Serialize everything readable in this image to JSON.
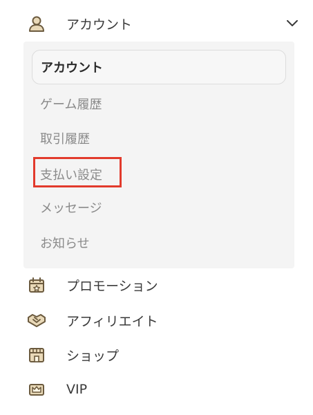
{
  "account": {
    "label": "アカウント",
    "icon": "user-icon",
    "expanded": true
  },
  "submenu": {
    "items": [
      {
        "label": "アカウント",
        "active": true
      },
      {
        "label": "ゲーム履歴"
      },
      {
        "label": "取引履歴"
      },
      {
        "label": "支払い設定",
        "highlighted": true
      },
      {
        "label": "メッセージ"
      },
      {
        "label": "お知らせ"
      }
    ]
  },
  "nav": {
    "items": [
      {
        "label": "プロモーション",
        "icon": "promotion-gift-icon"
      },
      {
        "label": "アフィリエイト",
        "icon": "handshake-icon"
      },
      {
        "label": "ショップ",
        "icon": "shop-icon"
      },
      {
        "label": "VIP",
        "icon": "vip-crown-icon"
      }
    ]
  },
  "colors": {
    "text": "#3a3a3a",
    "muted": "#8a8a8a",
    "submenu_bg": "#f4f4f4",
    "highlight": "#e23a2c",
    "icon_stroke": "#6b5a3e",
    "icon_fill": "#e9d9b8"
  }
}
